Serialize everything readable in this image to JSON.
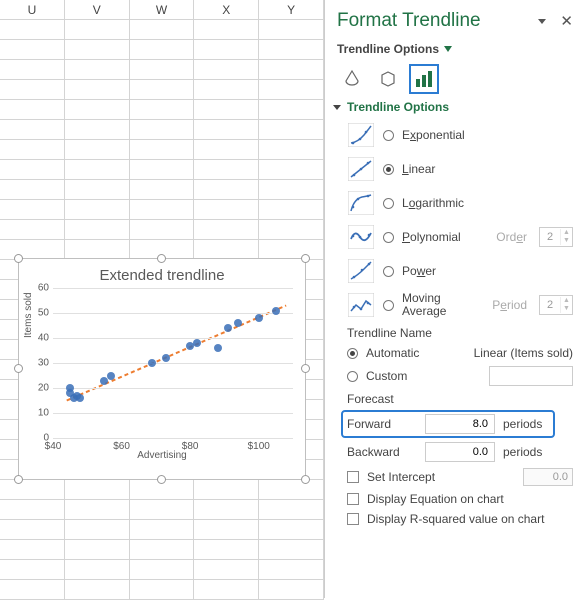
{
  "columns": [
    "U",
    "V",
    "W",
    "X",
    "Y"
  ],
  "chart": {
    "title": "Extended trendline",
    "ylabel": "Items sold",
    "xlabel": "Advertising",
    "xticks": [
      "$40",
      "$60",
      "$80",
      "$100"
    ],
    "yticks": [
      "0",
      "10",
      "20",
      "30",
      "40",
      "50",
      "60"
    ]
  },
  "chart_data": {
    "type": "scatter",
    "xlabel": "Advertising",
    "ylabel": "Items sold",
    "title": "Extended trendline",
    "xlim": [
      40,
      110
    ],
    "ylim": [
      0,
      60
    ],
    "series": [
      {
        "name": "Items sold",
        "x": [
          45,
          45,
          46,
          47,
          48,
          55,
          57,
          69,
          73,
          80,
          82,
          88,
          91,
          94,
          100,
          105
        ],
        "y": [
          18,
          20,
          16,
          17,
          16,
          23,
          25,
          30,
          32,
          37,
          38,
          36,
          44,
          46,
          48,
          51
        ]
      }
    ],
    "trendline": {
      "type": "linear",
      "x": [
        44,
        108
      ],
      "y": [
        15,
        53
      ],
      "style": "dashed",
      "color": "#ed7d31"
    }
  },
  "pane": {
    "title": "Format Trendline",
    "subtitle": "Trendline Options",
    "section": "Trendline Options",
    "opts": {
      "exp": "Exponential",
      "lin": "Linear",
      "log": "Logarithmic",
      "poly": "Polynomial",
      "pow": "Power",
      "mavg1": "Moving",
      "mavg2": "Average",
      "order": "Order",
      "period": "Period",
      "order_v": "2",
      "period_v": "2"
    },
    "name": {
      "hdr": "Trendline Name",
      "auto": "Automatic",
      "custom": "Custom",
      "auto_val": "Linear (Items sold)"
    },
    "forecast": {
      "hdr": "Forecast",
      "fwd": "Forward",
      "bwd": "Backward",
      "fwd_v": "8.0",
      "bwd_v": "0.0",
      "unit": "periods"
    },
    "intercept": {
      "label": "Set Intercept",
      "val": "0.0"
    },
    "eq": "Display Equation on chart",
    "r2": "Display R-squared value on chart",
    "underlines": {
      "exp": "x",
      "lin": "L",
      "log": "o",
      "poly": "P",
      "pow": "w",
      "auto": "A",
      "custom": "C",
      "fwd": "F",
      "bwd": "B",
      "si": "S",
      "eq": "E",
      "r2": "R",
      "period": "e"
    }
  }
}
